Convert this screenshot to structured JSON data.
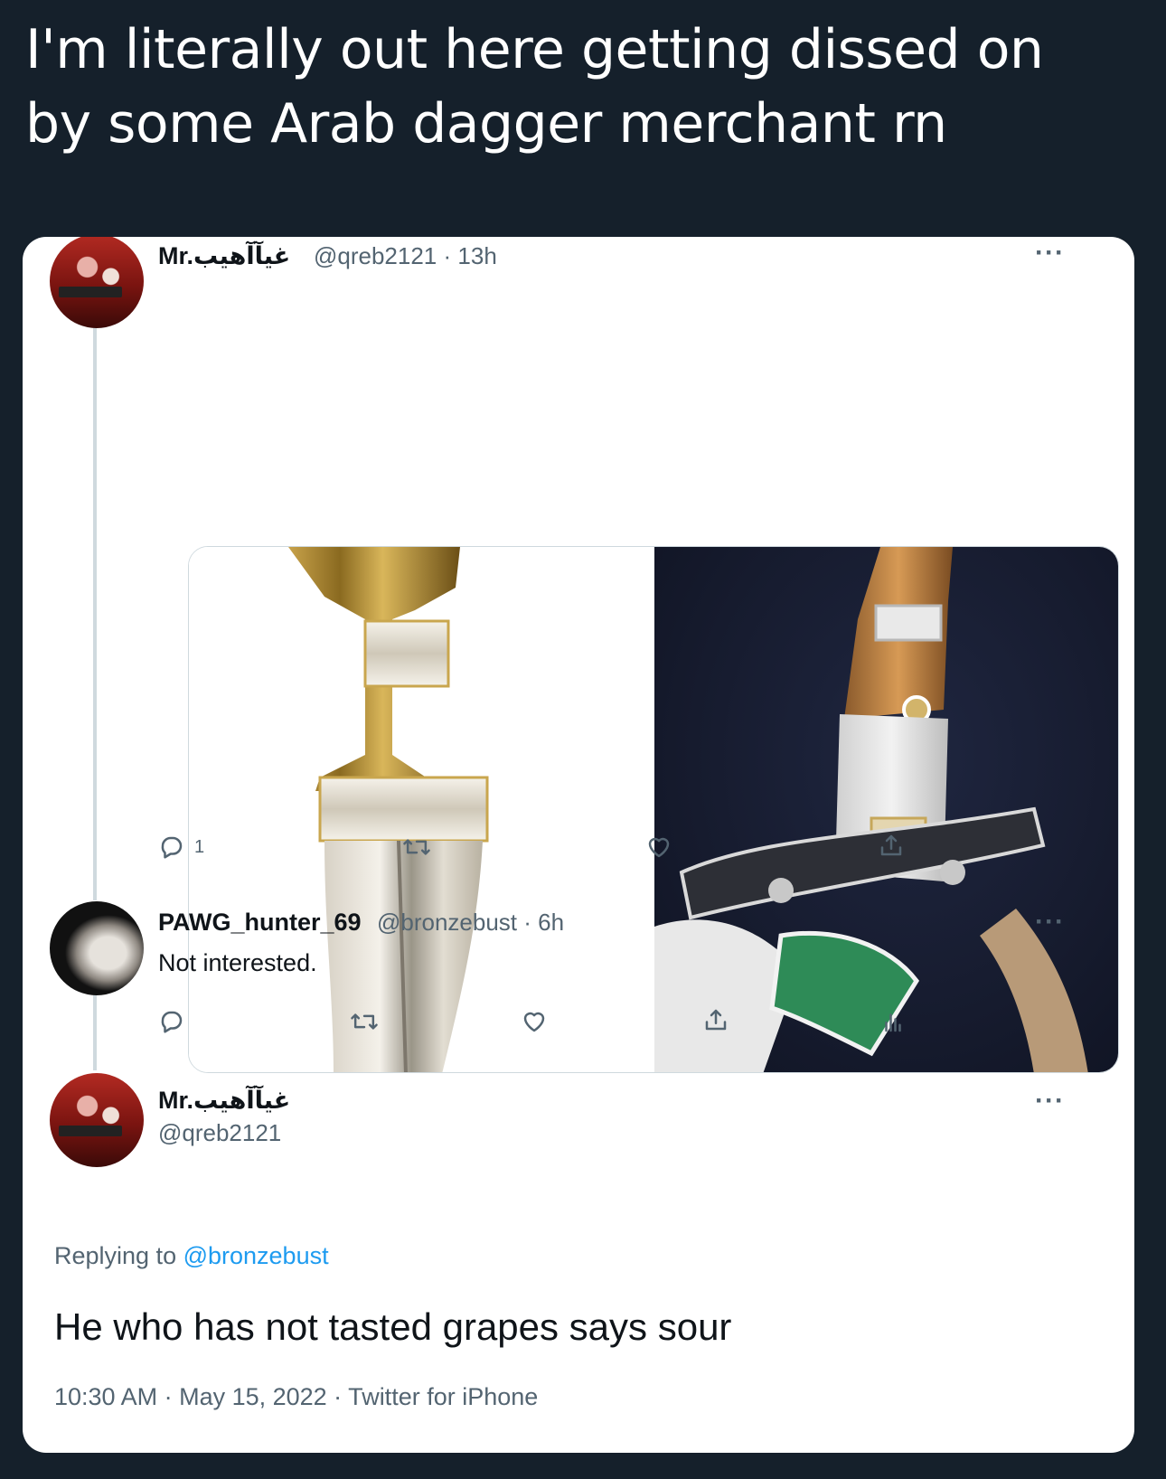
{
  "caption": {
    "line1": "I'm literally out here getting dissed on",
    "line2": "by some Arab dagger merchant rn"
  },
  "tweets": [
    {
      "display_name": "Mr.غيآآهيب",
      "handle": "@qreb2121",
      "time": "· 13h",
      "more": "···",
      "actions": {
        "reply_count": "1"
      }
    },
    {
      "display_name": "PAWG_hunter_69",
      "handle": "@bronzebust",
      "time": "· 6h",
      "text": "Not interested.",
      "more": "···"
    },
    {
      "display_name": "Mr.غيآآهيب",
      "handle": "@qreb2121",
      "more": "···",
      "replying_prefix": "Replying to ",
      "replying_to": "@bronzebust",
      "text": "He who has not tasted grapes says sour",
      "timestamp": "10:30 AM · May 15, 2022 · Twitter for iPhone"
    }
  ],
  "icons": {
    "reply": "reply-icon",
    "retweet": "retweet-icon",
    "like": "heart-icon",
    "share": "share-icon",
    "analytics": "analytics-icon"
  },
  "colors": {
    "background": "#15202b",
    "card": "#ffffff",
    "link": "#1d9bf0",
    "muted": "#536471"
  }
}
